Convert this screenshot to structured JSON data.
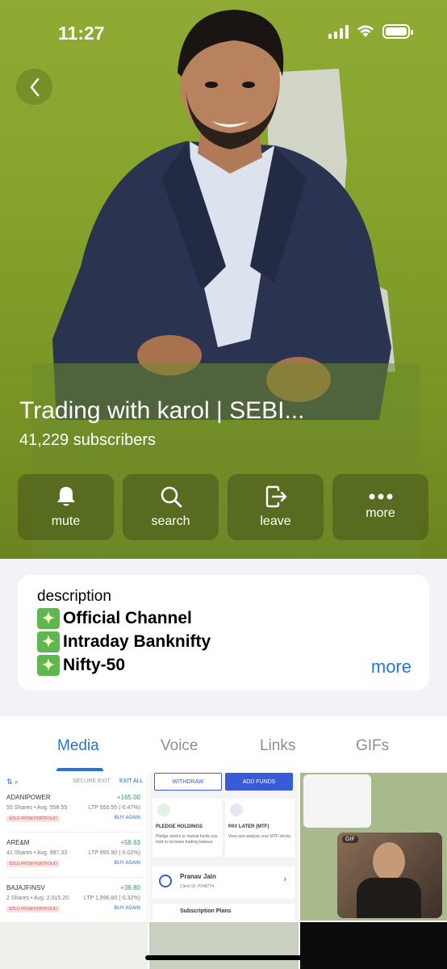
{
  "status_bar": {
    "time": "11:27"
  },
  "channel": {
    "title": "Trading with karol | SEBI...",
    "subscribers": "41,229 subscribers"
  },
  "actions": [
    {
      "label": "mute",
      "icon": "bell-icon"
    },
    {
      "label": "search",
      "icon": "search-icon"
    },
    {
      "label": "leave",
      "icon": "leave-icon"
    },
    {
      "label": "more",
      "icon": "more-icon"
    }
  ],
  "description": {
    "title": "description",
    "lines": [
      "Official Channel",
      "Intraday Banknifty",
      "Nifty-50"
    ],
    "more_label": "more"
  },
  "tabs": [
    {
      "label": "Media",
      "active": true
    },
    {
      "label": "Voice",
      "active": false
    },
    {
      "label": "Links",
      "active": false
    },
    {
      "label": "GIFs",
      "active": false
    }
  ],
  "media": {
    "portfolio": {
      "header_secure": "SECURE EXIT",
      "header_exit": "EXIT ALL",
      "rows": [
        {
          "name": "ADANIPOWER",
          "pnl": "+165.00",
          "shares": "55 Shares • Avg. 558.55",
          "ltp": "LTP 555.55 (-0.47%)",
          "tag": "SOLD FROM PORTFOLIO",
          "buy": "BUY AGAIN"
        },
        {
          "name": "ARE&M",
          "pnl": "+58.63",
          "shares": "41 Shares • Avg. 997.33",
          "ltp": "LTP 995.90 (-0.02%)",
          "tag": "SOLD FROM PORTFOLIO",
          "buy": "BUY AGAIN"
        },
        {
          "name": "BAJAJFINSV",
          "pnl": "+36.80",
          "shares": "2 Shares • Avg. 2,015.20",
          "ltp": "LTP 1,996.80 (-0.32%)",
          "tag": "SOLD FROM PORTFOLIO",
          "buy": "BUY AGAIN"
        }
      ]
    },
    "funds": {
      "withdraw": "WITHDRAW",
      "add_funds": "ADD FUNDS",
      "pledge_title": "PLEDGE HOLDINGS",
      "pledge_text": "Pledge stocks or mutual funds you hold to increase trading balance",
      "mtf_title": "PAY LATER (MTF)",
      "mtf_text": "View and analyse your MTF stocks",
      "user_name": "Pranav Jain",
      "client_id": "Client ID: P348774",
      "subscription": "Subscription Plans"
    },
    "gif_badge": "GIF"
  }
}
